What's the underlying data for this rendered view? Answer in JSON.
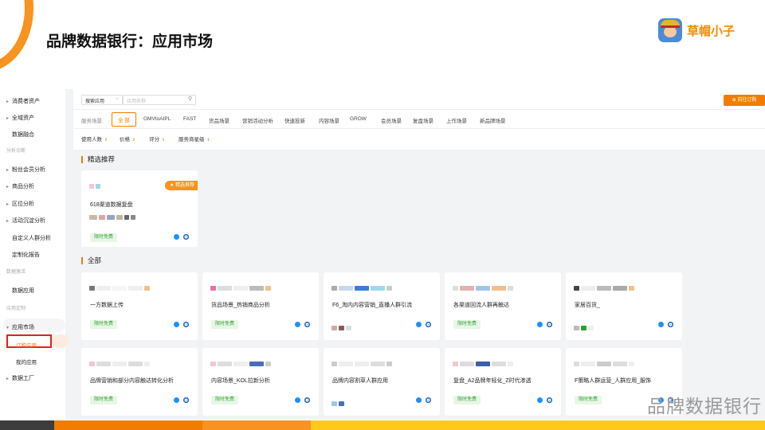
{
  "slide": {
    "title": "品牌数据银行：应用市场",
    "brand_name": "草帽小子",
    "watermark": "品牌数据银行"
  },
  "sidebar": {
    "items": [
      {
        "label": "消费者资产",
        "type": "group"
      },
      {
        "label": "全域资产",
        "type": "group"
      },
      {
        "label": "数据融合",
        "type": "sub"
      },
      {
        "label": "分析诊断",
        "type": "section"
      },
      {
        "label": "粉丝会员分析",
        "type": "group"
      },
      {
        "label": "商品分析",
        "type": "group"
      },
      {
        "label": "区位分析",
        "type": "group"
      },
      {
        "label": "活动沉淀分析",
        "type": "group"
      },
      {
        "label": "自定义人群分析",
        "type": "sub"
      },
      {
        "label": "定制化报告",
        "type": "sub"
      },
      {
        "label": "数据激活",
        "type": "section"
      },
      {
        "label": "数据应用",
        "type": "sub"
      },
      {
        "label": "应用定制",
        "type": "section"
      },
      {
        "label": "应用市场",
        "type": "open"
      },
      {
        "label": "订购应用",
        "type": "selected"
      },
      {
        "label": "我的应用",
        "type": "subsub"
      },
      {
        "label": "数据工厂",
        "type": "group"
      }
    ]
  },
  "toolbar": {
    "search_scope": "搜索应用",
    "search_placeholder": "应用名称",
    "order_button": "前往订购"
  },
  "filters": {
    "scenario_label": "服务场景:",
    "scenarios": [
      "全 部",
      "GMVtoAIPL",
      "FAST",
      "货品场景",
      "营销活动分析",
      "快速投新",
      "内容场景",
      "GROW",
      "会员场景",
      "复盘场景",
      "上作场景",
      "新品牌场景"
    ],
    "sorts": [
      "使用人数",
      "价格",
      "评分",
      "服务商星级"
    ]
  },
  "sections": {
    "featured": "精选推荐",
    "all": "全部"
  },
  "featured_card": {
    "name": "618渠道数据复盘",
    "badge": "★ 精选推荐",
    "price_tag": "限时免费"
  },
  "cards": [
    {
      "name": "一方数据上传",
      "price_tag": "限时免费"
    },
    {
      "name": "货品场景_热销商品分析",
      "price_tag": "限时免费"
    },
    {
      "name": "F6_淘内内容营销_直播人群引流",
      "price_tag": ""
    },
    {
      "name": "各渠道回流人群再触达",
      "price_tag": "限时免费"
    },
    {
      "name": "家居百货_",
      "price_tag": ""
    },
    {
      "name": "品牌营销和部分内容触达转化分析",
      "price_tag": "限时免费"
    },
    {
      "name": "内容场景_KOL拉新分析",
      "price_tag": "限时免费"
    },
    {
      "name": "品牌内容割草人群应用",
      "price_tag": ""
    },
    {
      "name": "复盘_A2品牌年轻化_Z时代渗透",
      "price_tag": "限时免费"
    },
    {
      "name": "F策略人群运营_人群应用_服饰",
      "price_tag": "限时免费"
    }
  ],
  "colors": {
    "accent": "#f07d00",
    "free_tag": "#3aa33a",
    "highlight_box": "#e0201f"
  }
}
